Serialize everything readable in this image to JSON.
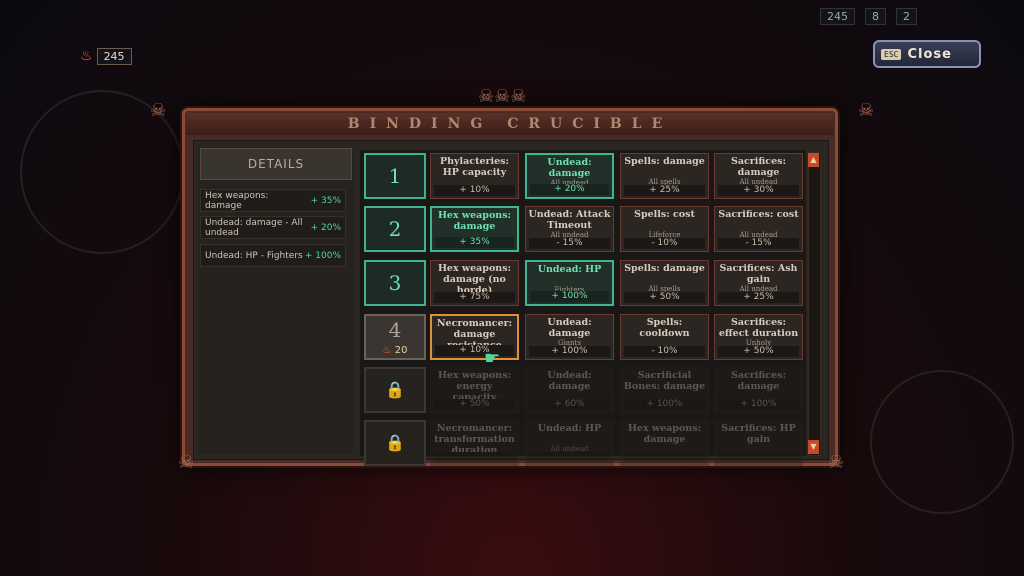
{
  "hud": {
    "currency": "245",
    "top_right": [
      "245",
      "8",
      "2"
    ],
    "close_key": "ESC",
    "close_label": "Close"
  },
  "panel": {
    "title": "BINDING CRUCIBLE",
    "details_title": "DETAILS",
    "details": [
      {
        "label": "Hex weapons: damage",
        "value": "+ 35%"
      },
      {
        "label": "Undead: damage - All undead",
        "value": "+ 20%"
      },
      {
        "label": "Undead: HP - Fighters",
        "value": "+ 100%"
      }
    ]
  },
  "tiers": [
    {
      "label": "1",
      "state": "unlocked",
      "cells": [
        {
          "title": "Phylacteries: HP capacity",
          "sub": "",
          "value": "+ 10%",
          "state": "normal"
        },
        {
          "title": "Undead: damage",
          "sub": "All undead",
          "value": "+ 20%",
          "state": "selected"
        },
        {
          "title": "Spells: damage",
          "sub": "All spells",
          "value": "+ 25%",
          "state": "normal"
        },
        {
          "title": "Sacrifices: damage",
          "sub": "All undead",
          "value": "+ 30%",
          "state": "normal"
        }
      ]
    },
    {
      "label": "2",
      "state": "unlocked",
      "cells": [
        {
          "title": "Hex weapons: damage",
          "sub": "",
          "value": "+ 35%",
          "state": "selected"
        },
        {
          "title": "Undead: Attack Timeout",
          "sub": "All undead",
          "value": "- 15%",
          "state": "normal"
        },
        {
          "title": "Spells: cost",
          "sub": "Lifeforce",
          "value": "- 10%",
          "state": "normal"
        },
        {
          "title": "Sacrifices: cost",
          "sub": "All undead",
          "value": "- 15%",
          "state": "normal"
        }
      ]
    },
    {
      "label": "3",
      "state": "unlocked",
      "cells": [
        {
          "title": "Hex weapons: damage (no horde)",
          "sub": "",
          "value": "+ 75%",
          "state": "normal"
        },
        {
          "title": "Undead: HP",
          "sub": "Fighters",
          "value": "+ 100%",
          "state": "selected"
        },
        {
          "title": "Spells: damage",
          "sub": "All spells",
          "value": "+ 50%",
          "state": "normal"
        },
        {
          "title": "Sacrifices: Ash gain",
          "sub": "All undead",
          "value": "+ 25%",
          "state": "normal"
        }
      ]
    },
    {
      "label": "4",
      "cost": "20",
      "state": "current",
      "cells": [
        {
          "title": "Necromancer: damage resistance",
          "sub": "",
          "value": "+ 10%",
          "state": "hover"
        },
        {
          "title": "Undead: damage",
          "sub": "Giants",
          "value": "+ 100%",
          "state": "normal"
        },
        {
          "title": "Spells: cooldown",
          "sub": "",
          "value": "- 10%",
          "state": "normal"
        },
        {
          "title": "Sacrifices: effect duration",
          "sub": "Unholy",
          "value": "+ 50%",
          "state": "normal"
        }
      ]
    },
    {
      "label": "🔒",
      "state": "locked",
      "cells": [
        {
          "title": "Hex weapons: energy capacity",
          "sub": "",
          "value": "+ 50%",
          "state": "dim"
        },
        {
          "title": "Undead: damage",
          "sub": "",
          "value": "+ 60%",
          "state": "dim"
        },
        {
          "title": "Sacrificial Bones: damage",
          "sub": "",
          "value": "+ 100%",
          "state": "dim"
        },
        {
          "title": "Sacrifices: damage",
          "sub": "",
          "value": "+ 100%",
          "state": "dim"
        }
      ]
    },
    {
      "label": "🔒",
      "state": "locked",
      "cells": [
        {
          "title": "Necromancer: transformation duration",
          "sub": "",
          "value": "",
          "state": "dim"
        },
        {
          "title": "Undead: HP",
          "sub": "All undead",
          "value": "",
          "state": "dim"
        },
        {
          "title": "Hex weapons: damage",
          "sub": "",
          "value": "",
          "state": "dim"
        },
        {
          "title": "Sacrifices: HP gain",
          "sub": "",
          "value": "",
          "state": "dim"
        }
      ]
    }
  ]
}
